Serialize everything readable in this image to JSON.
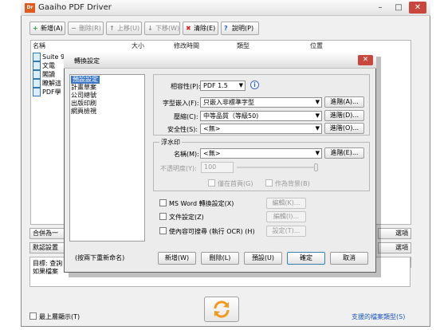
{
  "app": {
    "title": "Gaaiho PDF Driver",
    "icon_text": "Dr",
    "window_controls": [
      "–",
      "□",
      "✕"
    ]
  },
  "toolbar": {
    "add": "新增(A)",
    "remove": "刪除(R)",
    "move_up": "上移(U)",
    "move_down": "下移(W)",
    "clear": "清除(E)",
    "help": "說明(P)"
  },
  "list": {
    "columns": [
      "名稱",
      "大小",
      "修改時間",
      "類型",
      "位置"
    ],
    "rows": [
      "Suite 9",
      "文電",
      "閣讀",
      "瞭解這",
      "PDF學"
    ]
  },
  "side_buttons": {
    "merge": "合併為一",
    "default_settings": "默認設置",
    "btn1": "選項",
    "btn2": "選項",
    "btn3": "選項"
  },
  "target": {
    "line1": "目標: 查詢",
    "line2": "如果檔案"
  },
  "bottom": {
    "stay_on_top": "最上層顯示(T)",
    "supported_link": "支援的檔案類型(S)"
  },
  "dialog": {
    "title": "轉換設定",
    "close": "✕",
    "profiles": [
      "預設設定",
      "計畫草案",
      "公司總號",
      "出版印刷",
      "網頁檢視"
    ],
    "rename_hint": "(按兩下重新命名)",
    "compat_label": "相容性(P):",
    "compat_value": "PDF 1.5",
    "font_label": "字型嵌入(F):",
    "font_value": "只嵌入非標準字型",
    "font_adv": "進階(A)...",
    "compress_label": "壓縮(C):",
    "compress_value": "中等品質（等級50)",
    "compress_adv": "進階(D)...",
    "security_label": "安全性(S):",
    "security_value": "<無>",
    "security_adv": "進階(O)...",
    "watermark_group": "浮水印",
    "wm_name_label": "名稱(M):",
    "wm_name_value": "<無>",
    "wm_adv": "進階(E)...",
    "opacity_label": "不透明度(Y):",
    "opacity_value": "100",
    "first_page_only": "僅在首頁(G)",
    "as_background": "作為背景(B)",
    "msword_label": "MS Word 轉換設定(X)",
    "msword_btn": "編輯(K)...",
    "doc_label": "文件設定(Z)",
    "doc_btn": "編輯(I)...",
    "ocr_label": "使內容可搜尋 (執行 OCR) (H)",
    "ocr_btn": "設定(T)...",
    "new_btn": "新增(W)",
    "delete_btn": "刪除(L)",
    "default_btn": "預設(U)",
    "ok_btn": "確定",
    "cancel_btn": "取消"
  }
}
